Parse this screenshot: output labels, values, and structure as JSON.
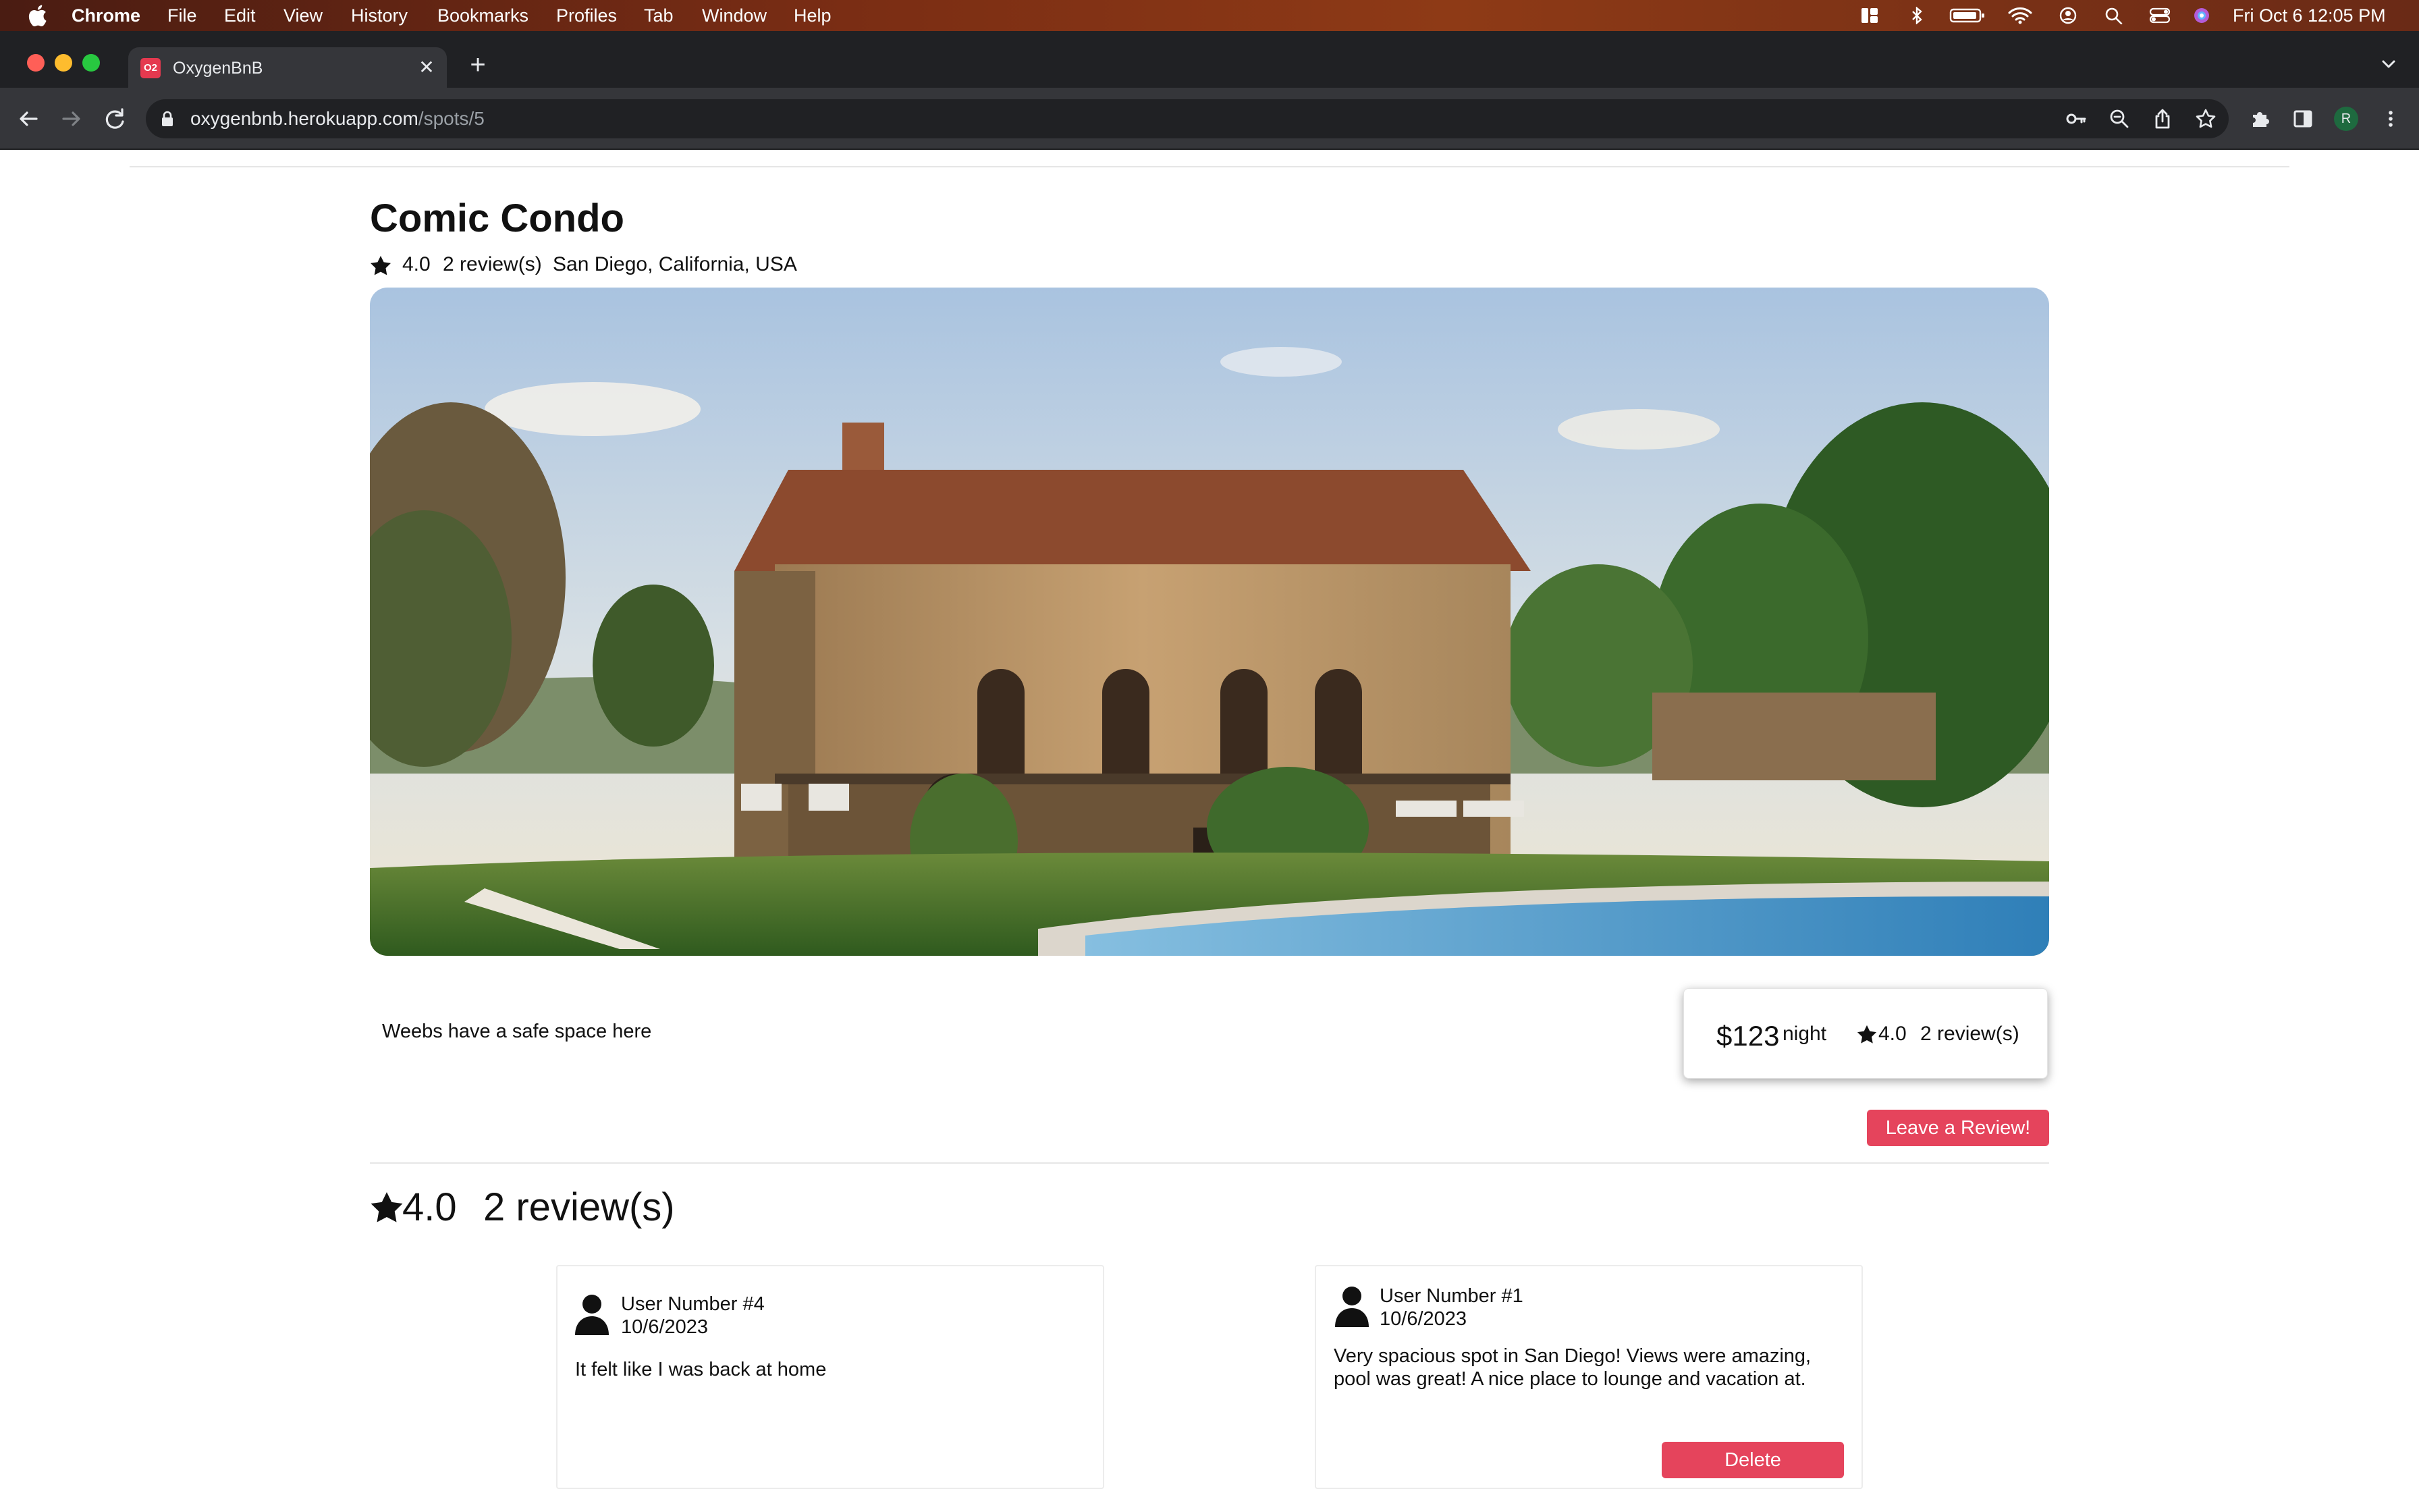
{
  "menubar": {
    "app_name": "Chrome",
    "menus": [
      "File",
      "Edit",
      "View",
      "History",
      "Bookmarks",
      "Profiles",
      "Tab",
      "Window",
      "Help"
    ],
    "clock": "Fri Oct 6  12:05 PM"
  },
  "browser": {
    "tab_title": "OxygenBnB",
    "favicon_text": "O2",
    "url_host": "oxygenbnb.herokuapp.com",
    "url_path": "/spots/5",
    "profile_initial": "R"
  },
  "spot": {
    "title": "Comic Condo",
    "rating": "4.0",
    "review_count": "2 review(s)",
    "location": "San Diego, California, USA",
    "description": "Weebs have a safe space here",
    "price": "$123",
    "price_unit": "night"
  },
  "actions": {
    "leave_review": "Leave a Review!",
    "delete": "Delete"
  },
  "reviews": [
    {
      "user": "User Number #4",
      "date": "10/6/2023",
      "text": "It felt like I was back at home"
    },
    {
      "user": "User Number #1",
      "date": "10/6/2023",
      "text": "Very spacious spot in San Diego! Views were amazing, pool was great! A nice place to lounge and vacation at."
    }
  ],
  "colors": {
    "accent": "#e5445c",
    "chrome_dark": "#202124",
    "chrome_toolbar": "#35363a"
  }
}
